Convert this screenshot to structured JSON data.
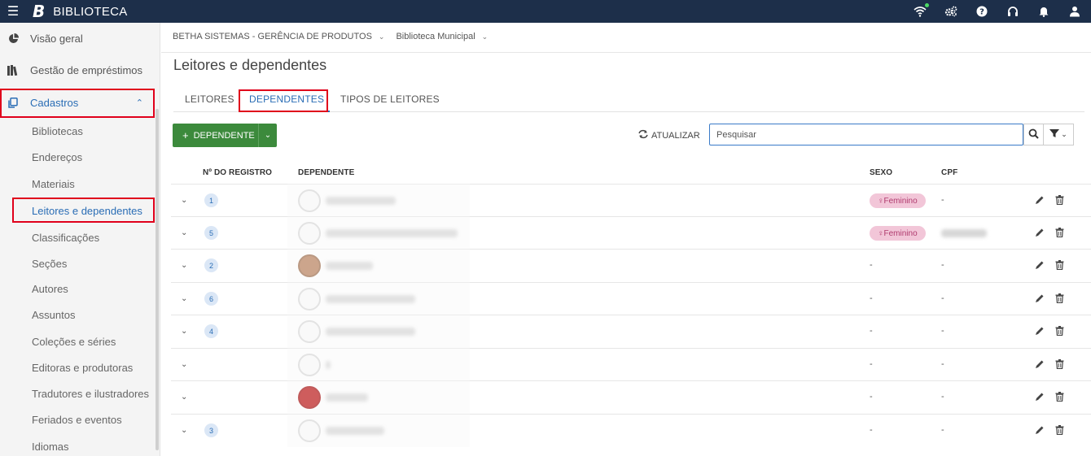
{
  "app": {
    "title": "BIBLIOTECA",
    "brand_letter": "B"
  },
  "topbar_icons": [
    "wifi-icon",
    "gears-icon",
    "help-icon",
    "headset-icon",
    "bell-icon",
    "user-icon"
  ],
  "sidebar": {
    "main_items": [
      {
        "label": "Visão geral",
        "icon": "pie-chart-icon"
      },
      {
        "label": "Gestão de empréstimos",
        "icon": "books-icon"
      },
      {
        "label": "Cadastros",
        "icon": "copy-icon"
      }
    ],
    "sub_items": [
      {
        "label": "Bibliotecas"
      },
      {
        "label": "Endereços"
      },
      {
        "label": "Materiais"
      },
      {
        "label": "Leitores e dependentes"
      },
      {
        "label": "Classificações"
      },
      {
        "label": "Seções"
      },
      {
        "label": "Autores"
      },
      {
        "label": "Assuntos"
      },
      {
        "label": "Coleções e séries"
      },
      {
        "label": "Editoras e produtoras"
      },
      {
        "label": "Tradutores e ilustradores"
      },
      {
        "label": "Feriados e eventos"
      },
      {
        "label": "Idiomas"
      }
    ]
  },
  "breadcrumb": {
    "org": "BETHA SISTEMAS - GERÊNCIA DE PRODUTOS",
    "library": "Biblioteca Municipal"
  },
  "page": {
    "title": "Leitores e dependentes"
  },
  "tabs": [
    {
      "label": "LEITORES",
      "active": false
    },
    {
      "label": "DEPENDENTES",
      "active": true
    },
    {
      "label": "TIPOS DE LEITORES",
      "active": false
    }
  ],
  "toolbar": {
    "add_label": "DEPENDENTE",
    "refresh_label": "ATUALIZAR",
    "search_placeholder": "Pesquisar"
  },
  "table": {
    "columns": [
      "Nº DO REGISTRO",
      "DEPENDENTE",
      "SEXO",
      "CPF"
    ],
    "rows": [
      {
        "registro": "1",
        "sexo": "Feminino",
        "cpf": "-",
        "avatar": "default",
        "name_blur": 86
      },
      {
        "registro": "5",
        "sexo": "Feminino",
        "cpf": "blurred",
        "avatar": "default",
        "name_blur": 162
      },
      {
        "registro": "2",
        "sexo": "-",
        "cpf": "-",
        "avatar": "photo",
        "name_blur": 58
      },
      {
        "registro": "6",
        "sexo": "-",
        "cpf": "-",
        "avatar": "default",
        "name_blur": 110
      },
      {
        "registro": "4",
        "sexo": "-",
        "cpf": "-",
        "avatar": "default",
        "name_blur": 110
      },
      {
        "registro": "",
        "sexo": "-",
        "cpf": "-",
        "avatar": "default",
        "name_blur": 6
      },
      {
        "registro": "",
        "sexo": "-",
        "cpf": "-",
        "avatar": "red",
        "name_blur": 52
      },
      {
        "registro": "3",
        "sexo": "-",
        "cpf": "-",
        "avatar": "default",
        "name_blur": 72
      }
    ]
  },
  "colors": {
    "topbar": "#1d2f4a",
    "accent": "#2a6db5",
    "add_button": "#3c8a3c",
    "highlight": "#e0001b",
    "female_pill": "#f2c6d8"
  }
}
